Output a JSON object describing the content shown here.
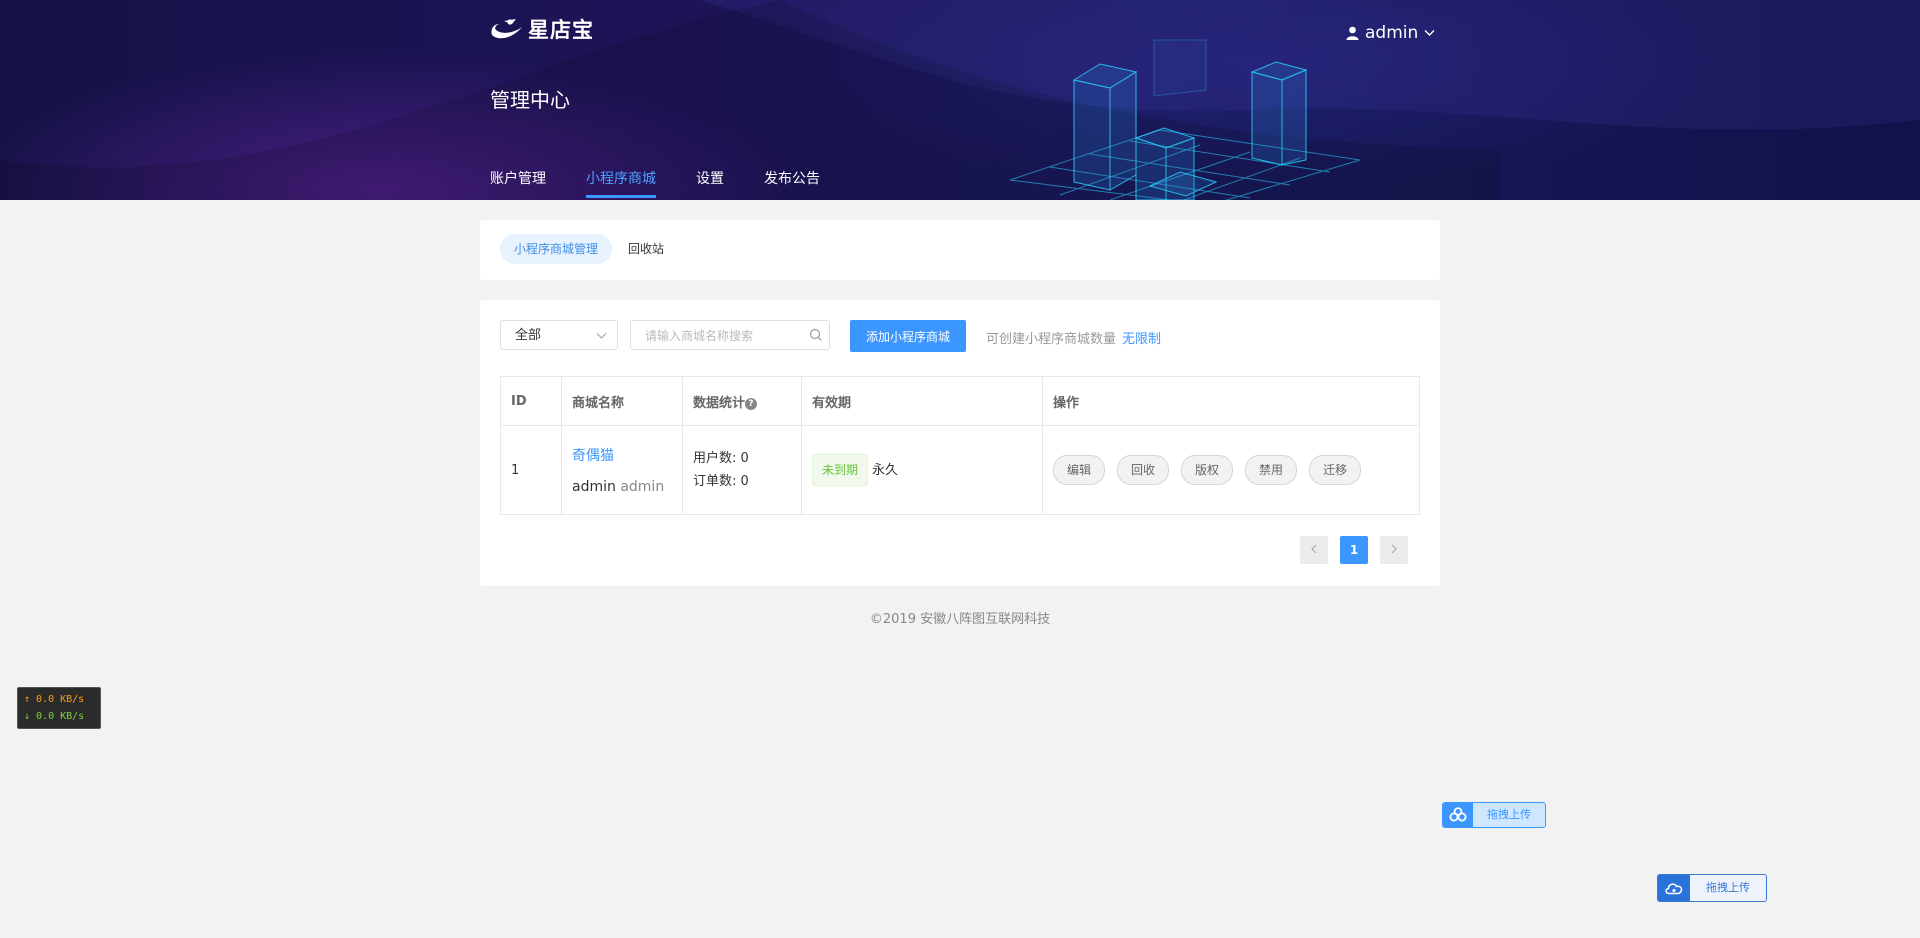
{
  "header": {
    "logo_text": "星店宝",
    "user_name": "admin",
    "page_title": "管理中心",
    "nav": [
      {
        "label": "账户管理",
        "active": false
      },
      {
        "label": "小程序商城",
        "active": true
      },
      {
        "label": "设置",
        "active": false
      },
      {
        "label": "发布公告",
        "active": false
      }
    ]
  },
  "subtabs": [
    {
      "label": "小程序商城管理",
      "active": true
    },
    {
      "label": "回收站",
      "active": false
    }
  ],
  "toolbar": {
    "filter_value": "全部",
    "search_placeholder": "请输入商城名称搜索",
    "add_button": "添加小程序商城",
    "quota_label": "可创建小程序商城数量",
    "quota_value": "无限制"
  },
  "table": {
    "headers": [
      "ID",
      "商城名称",
      "数据统计",
      "有效期",
      "操作"
    ],
    "rows": [
      {
        "id": "1",
        "name": "奇偶猫",
        "owner": "admin",
        "owner_sub": "admin",
        "users": "用户数: 0",
        "orders": "订单数: 0",
        "status": "未到期",
        "validity": "永久",
        "actions": [
          "编辑",
          "回收",
          "版权",
          "禁用",
          "迁移"
        ]
      }
    ]
  },
  "pagination": {
    "current": "1"
  },
  "footer": "©2019 安徽八阵图互联网科技",
  "speed_widget": {
    "up": "↑ 0.0 KB/s",
    "down": "↓ 0.0 KB/s"
  },
  "upload_widgets": [
    "拖拽上传",
    "拖拽上传"
  ],
  "colors": {
    "accent": "#3c96ff",
    "header_bg": "#1a1458",
    "page_bg": "#f2f2f2",
    "status_ok": "#67c23a"
  }
}
